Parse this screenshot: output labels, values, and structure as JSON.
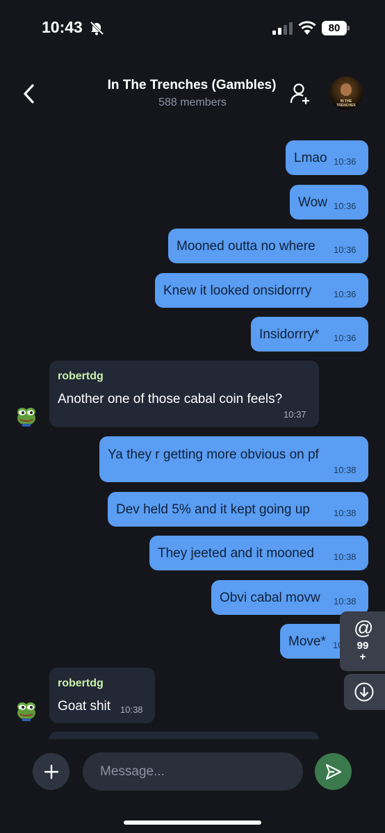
{
  "status_bar": {
    "time": "10:43",
    "battery": "80"
  },
  "header": {
    "title": "In The Trenches (Gambles)",
    "subtitle": "588 members",
    "avatar_text": "IN THE TRENCHES"
  },
  "messages": [
    {
      "text": "Lmao",
      "time": "10:36"
    },
    {
      "text": "Wow",
      "time": "10:36"
    },
    {
      "text": "Mooned outta no where",
      "time": "10:36"
    },
    {
      "text": "Knew it looked onsidorrry",
      "time": "10:36"
    },
    {
      "text": "Insidorrry*",
      "time": "10:36"
    },
    {
      "sender": "robertdg",
      "text": "Another one of those cabal coin feels?",
      "time": "10:37"
    },
    {
      "text": "Ya they r getting more obvious on pf",
      "time": "10:38"
    },
    {
      "text": "Dev held 5% and it kept going up",
      "time": "10:38"
    },
    {
      "text": "They jeeted and it mooned",
      "time": "10:38"
    },
    {
      "text": "Obvi cabal movw",
      "time": "10:38"
    },
    {
      "text": "Move*",
      "time": "10:38"
    },
    {
      "sender": "robertdg",
      "text": "Goat shit",
      "time": "10:38"
    }
  ],
  "mentions": {
    "symbol": "@",
    "count": "99",
    "plus": "+"
  },
  "composer": {
    "placeholder": "Message..."
  },
  "colors": {
    "outgoing": "#5a9df2",
    "incoming": "#222836",
    "sender": "#c8f2a8",
    "send_button": "#3a7a4c"
  }
}
